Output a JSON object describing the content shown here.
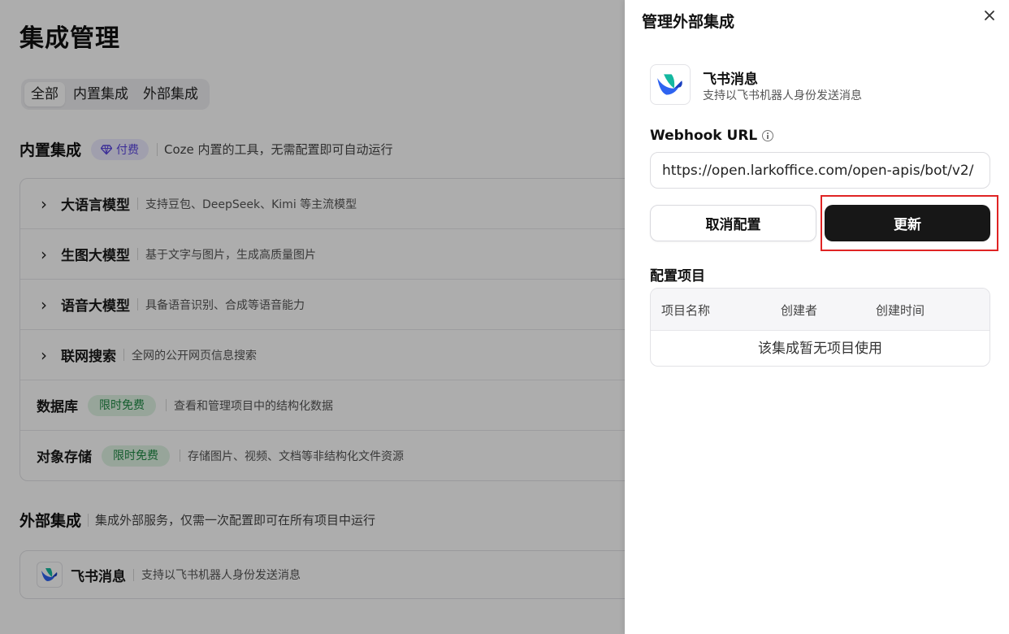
{
  "page": {
    "title": "集成管理",
    "tabs": [
      "全部",
      "内置集成",
      "外部集成"
    ]
  },
  "builtin": {
    "title": "内置集成",
    "badge": "付费",
    "desc": "Coze 内置的工具，无需配置即可自动运行",
    "items": [
      {
        "name": "大语言模型",
        "desc": "支持豆包、DeepSeek、Kimi 等主流模型"
      },
      {
        "name": "生图大模型",
        "desc": "基于文字与图片，生成高质量图片"
      },
      {
        "name": "语音大模型",
        "desc": "具备语音识别、合成等语音能力"
      },
      {
        "name": "联网搜索",
        "desc": "全网的公开网页信息搜索"
      },
      {
        "name": "数据库",
        "badge": "限时免费",
        "desc": "查看和管理项目中的结构化数据"
      },
      {
        "name": "对象存储",
        "badge": "限时免费",
        "desc": "存储图片、视频、文档等非结构化文件资源"
      }
    ]
  },
  "external": {
    "title": "外部集成",
    "desc": "集成外部服务，仅需一次配置即可在所有项目中运行",
    "items": [
      {
        "name": "飞书消息",
        "desc": "支持以飞书机器人身份发送消息"
      }
    ]
  },
  "drawer": {
    "title": "管理外部集成",
    "integration": {
      "name": "飞书消息",
      "desc": "支持以飞书机器人身份发送消息"
    },
    "webhook_label": "Webhook URL",
    "webhook_value": "https://open.larkoffice.com/open-apis/bot/v2/",
    "cancel_label": "取消配置",
    "update_label": "更新",
    "config_title": "配置项目",
    "columns": [
      "项目名称",
      "创建者",
      "创建时间"
    ],
    "empty_text": "该集成暂无项目使用"
  },
  "colors": {
    "accent_dark": "#171717",
    "paid_badge": "#5a46e0",
    "free_badge": "#1f8a45",
    "highlight": "#e02424"
  }
}
